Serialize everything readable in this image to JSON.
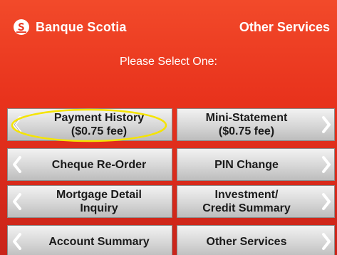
{
  "header": {
    "bank_name": "Banque Scotia",
    "logo_icon": "scotiabank-logo-icon",
    "section_title": "Other Services"
  },
  "prompt": "Please Select One:",
  "options": {
    "payment_history": {
      "line1": "Payment History",
      "line2": "($0.75 fee)"
    },
    "mini_statement": {
      "line1": "Mini-Statement",
      "line2": "($0.75 fee)"
    },
    "cheque_reorder": {
      "line1": "Cheque Re-Order"
    },
    "pin_change": {
      "line1": "PIN Change"
    },
    "mortgage_detail": {
      "line1": "Mortgage Detail",
      "line2": "Inquiry"
    },
    "investment_credit": {
      "line1": "Investment/",
      "line2": "Credit Summary"
    },
    "account_summary": {
      "line1": "Account Summary"
    },
    "other_services": {
      "line1": "Other Services"
    }
  },
  "icons": {
    "left_arrow": "chevron-left-icon",
    "right_arrow": "chevron-right-icon"
  },
  "colors": {
    "background": "#e8321c",
    "button": "#d6d6d6",
    "highlight_ellipse": "#f5e400"
  }
}
